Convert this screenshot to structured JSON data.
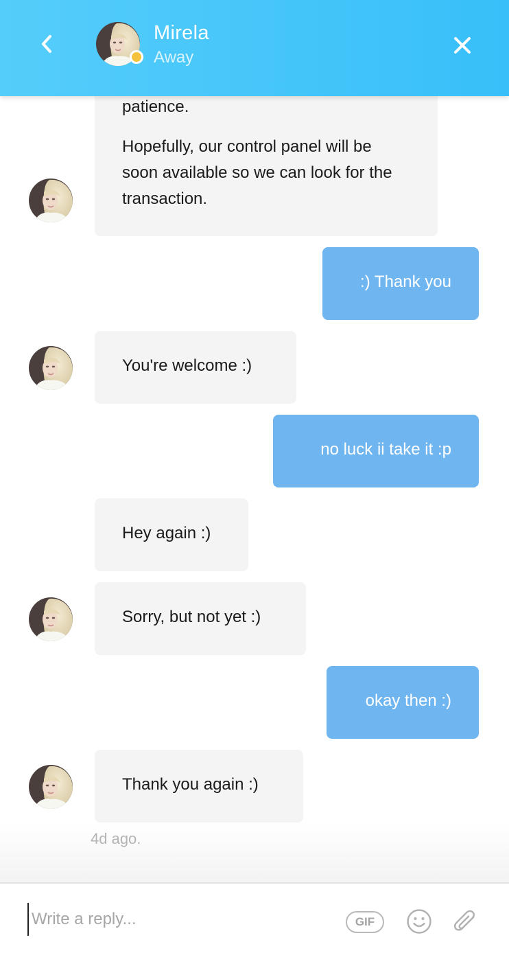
{
  "header": {
    "agent_name": "Mirela",
    "agent_status": "Away",
    "status_color": "#f5c23b",
    "back_icon": "chevron-left-icon",
    "close_icon": "close-icon",
    "gradient": [
      "#55cdfa",
      "#38bff9"
    ]
  },
  "messages": [
    {
      "from": "agent",
      "paragraphs": [
        "patience.",
        "Hopefully, our control panel will be soon available so we can look for the transaction."
      ],
      "avatar": true
    },
    {
      "from": "user",
      "text": ":) Thank you"
    },
    {
      "from": "agent",
      "text": "You're welcome :)",
      "avatar": true
    },
    {
      "from": "user",
      "text": "no luck ii take it :p"
    },
    {
      "from": "agent",
      "text": "Hey again :)",
      "avatar": false
    },
    {
      "from": "agent",
      "text": "Sorry, but not yet :)",
      "avatar": true
    },
    {
      "from": "user",
      "text": "okay then :)"
    },
    {
      "from": "agent",
      "text": "Thank you again :)",
      "avatar": true
    }
  ],
  "timestamp": "4d ago.",
  "composer": {
    "placeholder": "Write a reply...",
    "gif_label": "GIF",
    "emoji_icon": "smiley-icon",
    "attach_icon": "paperclip-icon"
  },
  "colors": {
    "agent_bubble": "#f4f4f4",
    "user_bubble": "#6fb5f0"
  }
}
